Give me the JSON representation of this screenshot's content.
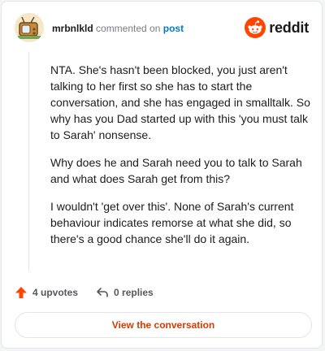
{
  "header": {
    "username": "mrbnlkld",
    "action_text": "commented on",
    "target_text": "post",
    "brand_name": "reddit"
  },
  "comment": {
    "paragraphs": [
      "NTA. She's hasn't been blocked, you just aren't talking to her first so she has to start the conversation, and she has engaged in smalltalk. So why has you Dad started up with this 'you must talk to Sarah' nonsense.",
      "Why does he and Sarah need you to talk to Sarah and what does Sarah get from this?",
      "I wouldn't 'get over this'. None of Sarah's current behaviour indicates remorse at what she did, so there's a good chance she'll do it again."
    ]
  },
  "actions": {
    "upvotes_label": "4 upvotes",
    "replies_label": "0 replies"
  },
  "cta": {
    "label": "View the conversation"
  },
  "colors": {
    "accent": "#d93a00",
    "reddit_orange": "#ff4500",
    "link_blue": "#0079d3",
    "upvote": "#ff4500"
  }
}
